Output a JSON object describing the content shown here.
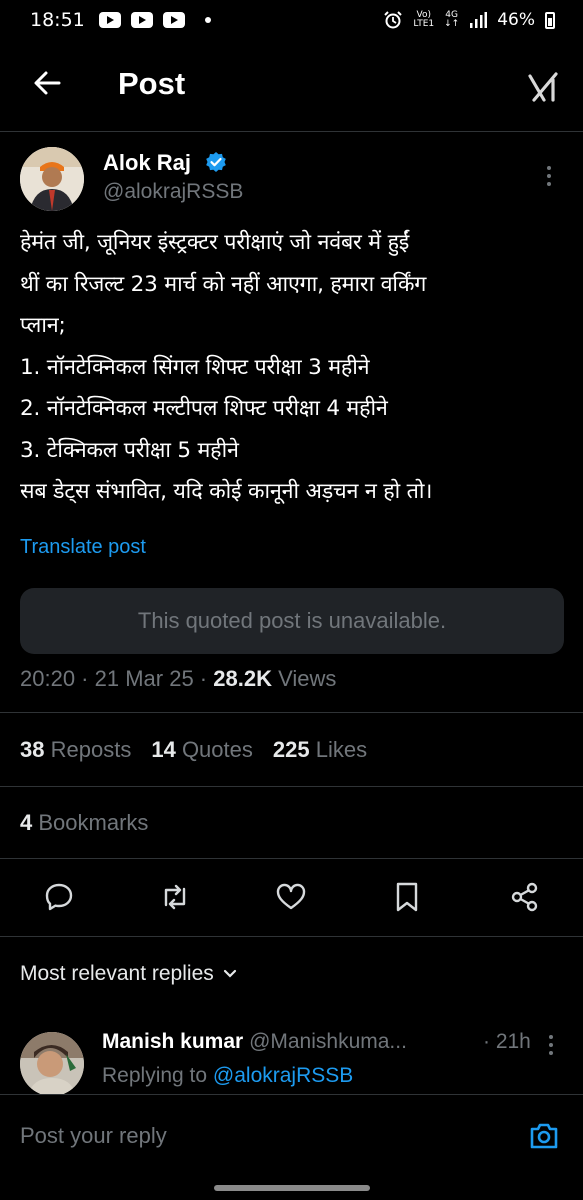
{
  "status_bar": {
    "time": "18:51",
    "network": "4G",
    "sim_label_top": "Vo)",
    "sim_label_bottom": "LTE1",
    "battery": "46%"
  },
  "header": {
    "title": "Post",
    "back_icon": "arrow-left-icon",
    "grok_icon": "grok-icon"
  },
  "post": {
    "author_name": "Alok Raj",
    "author_handle": "@alokrajRSSB",
    "verified": true,
    "body": "हेमंत जी, जूनियर इंस्ट्रक्टर परीक्षाएं जो नवंबर में हुईं\nथीं का रिजल्ट 23 मार्च को नहीं आएगा, हमारा वर्किंग\nप्लान;\n1. नॉनटेक्निकल सिंगल शिफ्ट परीक्षा 3 महीने\n2. नॉनटेक्निकल मल्टीपल शिफ्ट परीक्षा 4 महीने\n3. टेक्निकल परीक्षा 5 महीने\nसब डेट्स संभावित, यदि कोई कानूनी अड़चन न हो तो।",
    "translate_label": "Translate post",
    "quoted_unavailable": "This quoted post is unavailable.",
    "time": "20:20",
    "date": "21 Mar 25",
    "views_count": "28.2K",
    "views_label": "Views",
    "reposts_count": "38",
    "reposts_label": "Reposts",
    "quotes_count": "14",
    "quotes_label": "Quotes",
    "likes_count": "225",
    "likes_label": "Likes",
    "bookmarks_count": "4",
    "bookmarks_label": "Bookmarks"
  },
  "actions": [
    "reply-icon",
    "repost-icon",
    "like-icon",
    "bookmark-icon",
    "share-icon"
  ],
  "replies": {
    "sort_label": "Most relevant replies",
    "items": [
      {
        "name": "Manish kumar",
        "handle": "@Manishkuma...",
        "time": "· 21h",
        "replying_prefix": "Replying to",
        "replying_handle": "@alokrajRSSB"
      }
    ]
  },
  "composer": {
    "placeholder": "Post your reply"
  },
  "colors": {
    "accent": "#1d9bf0",
    "muted": "#71767b",
    "background": "#000000"
  }
}
